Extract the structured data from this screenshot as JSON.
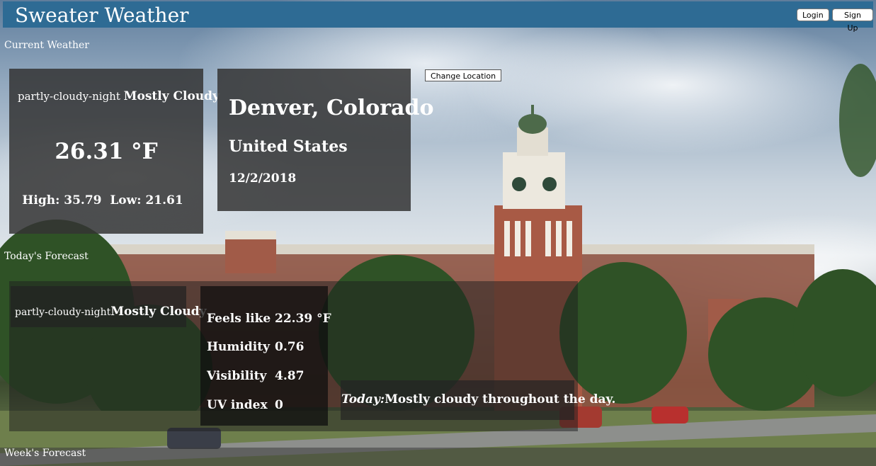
{
  "header": {
    "brand": "Sweater Weather",
    "login_label": "Login",
    "signup_label": "Sign Up"
  },
  "sections": {
    "current": "Current Weather",
    "today": "Today's Forecast",
    "week": "Week's Forecast"
  },
  "current": {
    "icon_text": "partly-cloudy-night",
    "summary": "Mostly Cloudy",
    "temperature": "26.31 °F",
    "high_low": "High: 35.79  Low: 21.61"
  },
  "location": {
    "city": "Denver, Colorado",
    "country": "United States",
    "date": "12/2/2018",
    "change_label": "Change Location"
  },
  "today": {
    "icon_text": "partly-cloudy-night",
    "summary": "Mostly Cloudy",
    "details": [
      {
        "label": "Feels like",
        "value": "22.39 °F"
      },
      {
        "label": "Humidity",
        "value": "0.76"
      },
      {
        "label": "Visibility",
        "value": "4.87"
      },
      {
        "label": "UV index",
        "value": "0"
      }
    ],
    "forecast_prefix": "Today:",
    "forecast_text": "Mostly cloudy throughout the day."
  },
  "colors": {
    "header_bg": "#2e6b94",
    "panel_bg": "#343434"
  }
}
